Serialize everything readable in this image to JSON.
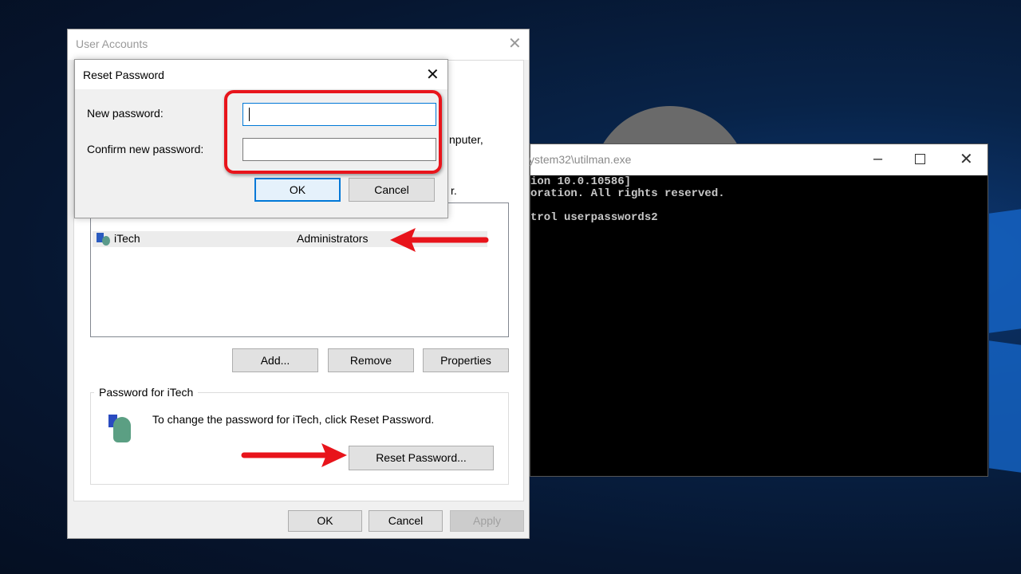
{
  "user_accounts": {
    "title": "User Accounts",
    "partial_text_1": "nputer,",
    "partial_text_2": "r.",
    "users": [
      {
        "name": "iTech",
        "group": "Administrators"
      }
    ],
    "buttons": {
      "add": "Add...",
      "remove": "Remove",
      "properties": "Properties"
    },
    "password_group_label": "Password for iTech",
    "password_text": "To change the password for iTech, click Reset Password.",
    "reset_password_button": "Reset Password...",
    "footer": {
      "ok": "OK",
      "cancel": "Cancel",
      "apply": "Apply"
    }
  },
  "reset_dialog": {
    "title": "Reset Password",
    "new_password_label": "New password:",
    "confirm_password_label": "Confirm new password:",
    "new_password_value": "",
    "confirm_password_value": "",
    "ok": "OK",
    "cancel": "Cancel"
  },
  "cmd": {
    "title": "ystem32\\utilman.exe",
    "lines": [
      "ion 10.0.10586]",
      "oration. All rights reserved.",
      "",
      "trol userpasswords2"
    ]
  },
  "colors": {
    "annotation": "#e8141b",
    "accent": "#0078d7"
  }
}
